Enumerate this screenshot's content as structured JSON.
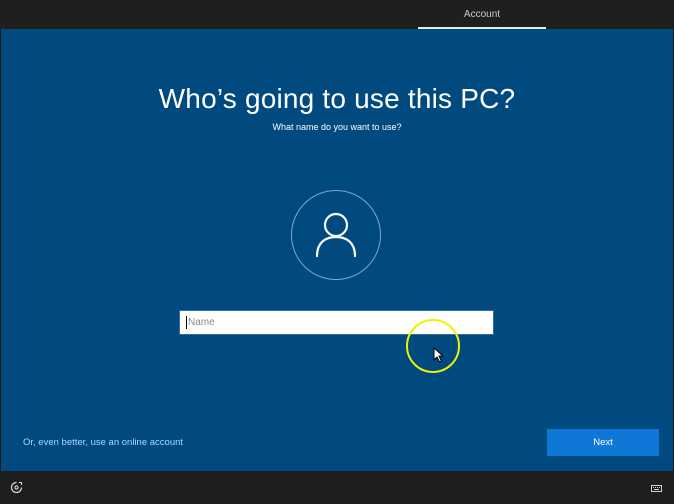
{
  "header": {
    "tab_label": "Account"
  },
  "main": {
    "title": "Who’s going to use this PC?",
    "subtitle": "What name do you want to use?",
    "avatar_icon": "user-icon",
    "name_input": {
      "value": "",
      "placeholder": "Name"
    },
    "online_account_link": "Or, even better, use an online account",
    "next_button": "Next"
  },
  "footer": {
    "left_icon": "ease-of-access-icon",
    "right_icon": "keyboard-icon"
  },
  "colors": {
    "background": "#004a80",
    "accent": "#0f78d7",
    "link": "#a9d8ff",
    "cursor_highlight": "#f4f000"
  }
}
